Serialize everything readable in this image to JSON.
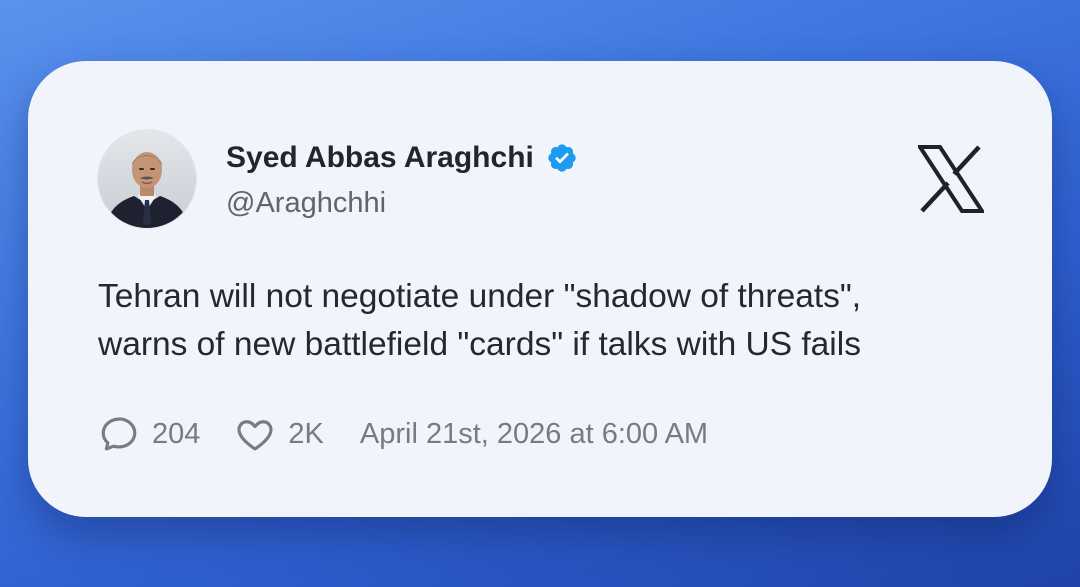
{
  "author": {
    "display_name": "Syed Abbas Araghchi",
    "handle": "@Araghchhi",
    "verified": true,
    "avatar_icon": "person-photo"
  },
  "brand": {
    "logo_icon": "x-logo-icon"
  },
  "tweet": {
    "text_lines": [
      "Tehran will not negotiate under \"shadow of threats\",",
      "warns of new battlefield \"cards\" if talks with US fails"
    ]
  },
  "stats": {
    "replies": "204",
    "likes": "2K",
    "timestamp": "April 21st, 2026 at 6:00 AM"
  },
  "colors": {
    "verified_badge": "#1d9bf0",
    "card_background": "#f1f4fa",
    "background_gradient_start": "#5a92ee",
    "background_gradient_end": "#1f43a8",
    "meta_text": "#747c88"
  }
}
